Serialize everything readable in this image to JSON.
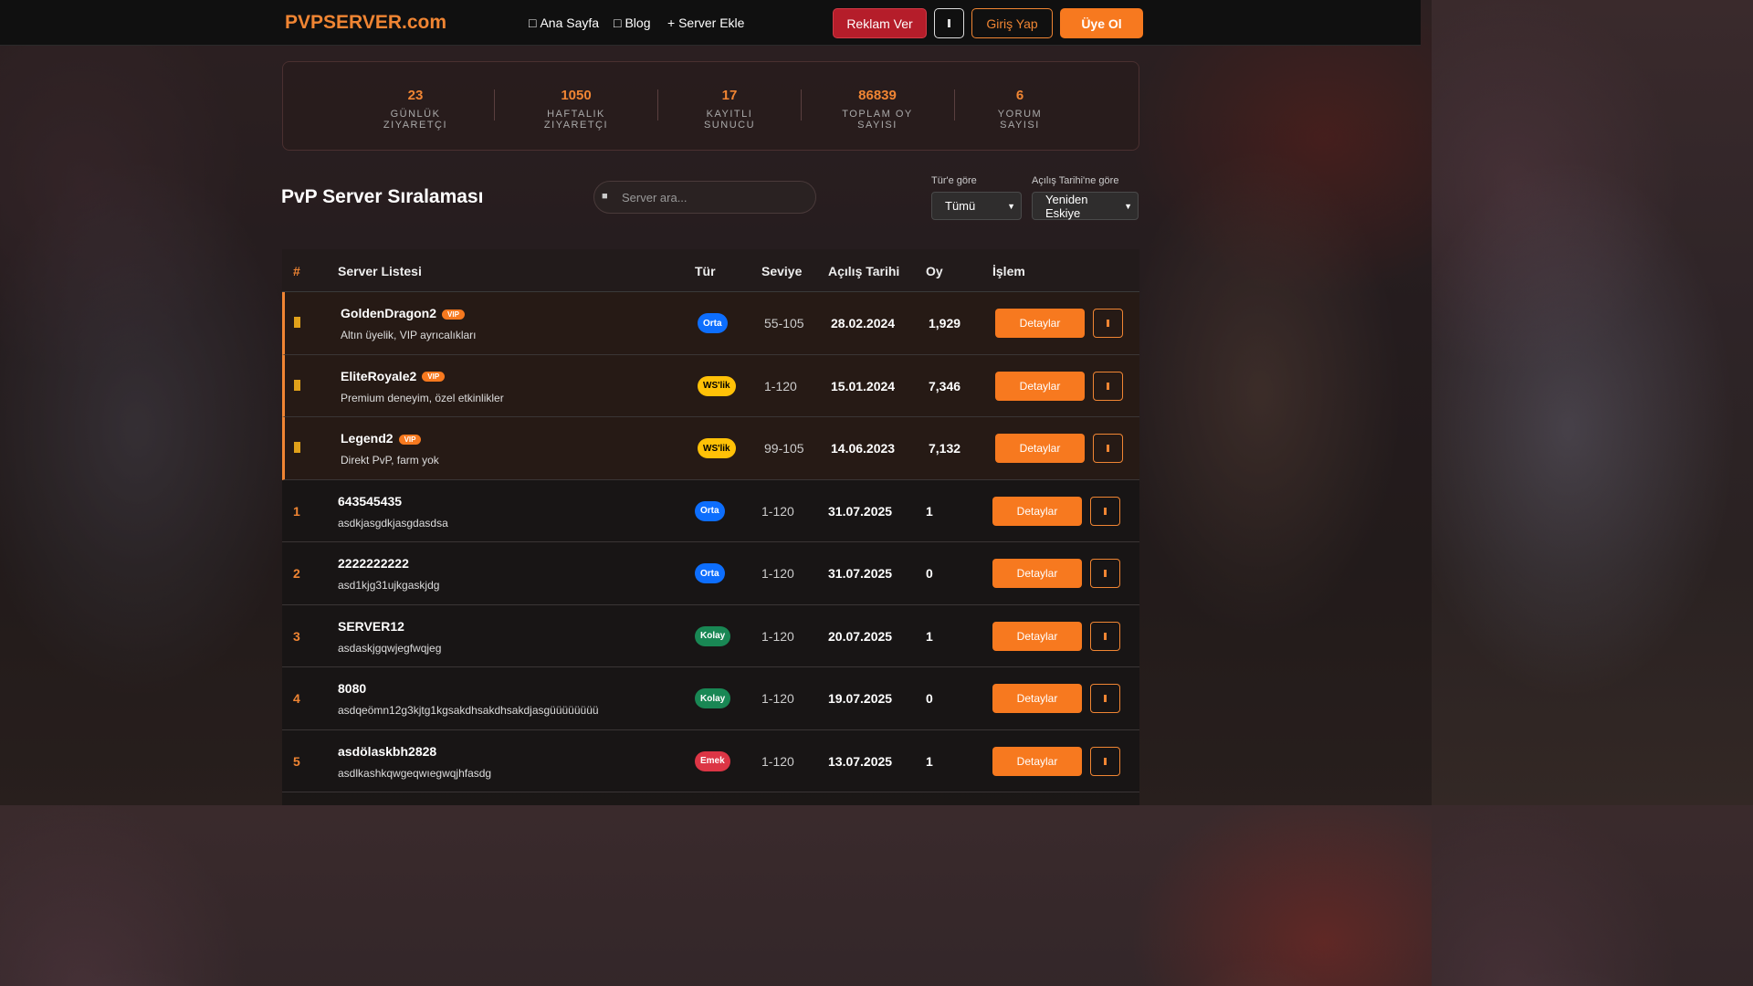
{
  "nav": {
    "logo": "PVPSERVER.com",
    "links": [
      {
        "label": "Ana Sayfa",
        "icon": "home-icon"
      },
      {
        "label": "Blog",
        "icon": "blog-icon"
      },
      {
        "label": "+ Server Ekle",
        "icon": ""
      }
    ],
    "reklam": "Reklam Ver",
    "theme_icon": "theme-toggle-icon",
    "giris": "Giriş Yap",
    "uye": "Üye Ol"
  },
  "stats": [
    {
      "value": "23",
      "label": "Günlük Ziyaretçi"
    },
    {
      "value": "1050",
      "label": "Haftalık Ziyaretçi"
    },
    {
      "value": "17",
      "label": "Kayıtlı Sunucu"
    },
    {
      "value": "86839",
      "label": "Toplam Oy Sayısı"
    },
    {
      "value": "6",
      "label": "Yorum Sayısı"
    }
  ],
  "main": {
    "title": "PvP Server Sıralaması",
    "search_placeholder": "Server ara...",
    "filter_type_label": "Tür'e göre",
    "filter_type_value": "Tümü",
    "filter_date_label": "Açılış Tarihi'ne göre",
    "filter_date_value": "Yeniden Eskiye"
  },
  "table": {
    "headers": [
      "#",
      "Server Listesi",
      "Tür",
      "Seviye",
      "Açılış Tarihi",
      "Oy",
      "İşlem"
    ],
    "detail_label": "Detaylar",
    "rows": [
      {
        "rank": "",
        "vip": true,
        "vip_label": "VIP",
        "name": "GoldenDragon2",
        "desc": "Altın üyelik, VIP ayrıcalıkları",
        "type": "Orta",
        "type_color": "#0d6efd",
        "type_text": "#ffffff",
        "level": "55-105",
        "date": "28.02.2024",
        "votes": "1,929"
      },
      {
        "rank": "",
        "vip": true,
        "vip_label": "VIP",
        "name": "EliteRoyale2",
        "desc": "Premium deneyim, özel etkinlikler",
        "type": "WS'lik",
        "type_color": "#ffc107",
        "type_text": "#000000",
        "level": "1-120",
        "date": "15.01.2024",
        "votes": "7,346"
      },
      {
        "rank": "",
        "vip": true,
        "vip_label": "VIP",
        "name": "Legend2",
        "desc": "Direkt PvP, farm yok",
        "type": "WS'lik",
        "type_color": "#ffc107",
        "type_text": "#000000",
        "level": "99-105",
        "date": "14.06.2023",
        "votes": "7,132"
      },
      {
        "rank": "1",
        "vip": false,
        "vip_label": "",
        "name": "643545435",
        "desc": "asdkjasgdkjasgdasdsa",
        "type": "Orta",
        "type_color": "#0d6efd",
        "type_text": "#ffffff",
        "level": "1-120",
        "date": "31.07.2025",
        "votes": "1"
      },
      {
        "rank": "2",
        "vip": false,
        "vip_label": "",
        "name": "2222222222",
        "desc": "asd1kjg31ujkgaskjdg",
        "type": "Orta",
        "type_color": "#0d6efd",
        "type_text": "#ffffff",
        "level": "1-120",
        "date": "31.07.2025",
        "votes": "0"
      },
      {
        "rank": "3",
        "vip": false,
        "vip_label": "",
        "name": "SERVER12",
        "desc": "asdaskjgqwjegfwqjeg",
        "type": "Kolay",
        "type_color": "#198754",
        "type_text": "#ffffff",
        "level": "1-120",
        "date": "20.07.2025",
        "votes": "1"
      },
      {
        "rank": "4",
        "vip": false,
        "vip_label": "",
        "name": "8080",
        "desc": "asdqeömn12g3kjtg1kgsakdhsakdhsakdjasgüüüüüüüü",
        "type": "Kolay",
        "type_color": "#198754",
        "type_text": "#ffffff",
        "level": "1-120",
        "date": "19.07.2025",
        "votes": "0"
      },
      {
        "rank": "5",
        "vip": false,
        "vip_label": "",
        "name": "asdölaskbh2828",
        "desc": "asdlkashkqwgeqwıegwqjhfasdg",
        "type": "Emek",
        "type_color": "#dc3545",
        "type_text": "#ffffff",
        "level": "1-120",
        "date": "13.07.2025",
        "votes": "1"
      }
    ]
  }
}
